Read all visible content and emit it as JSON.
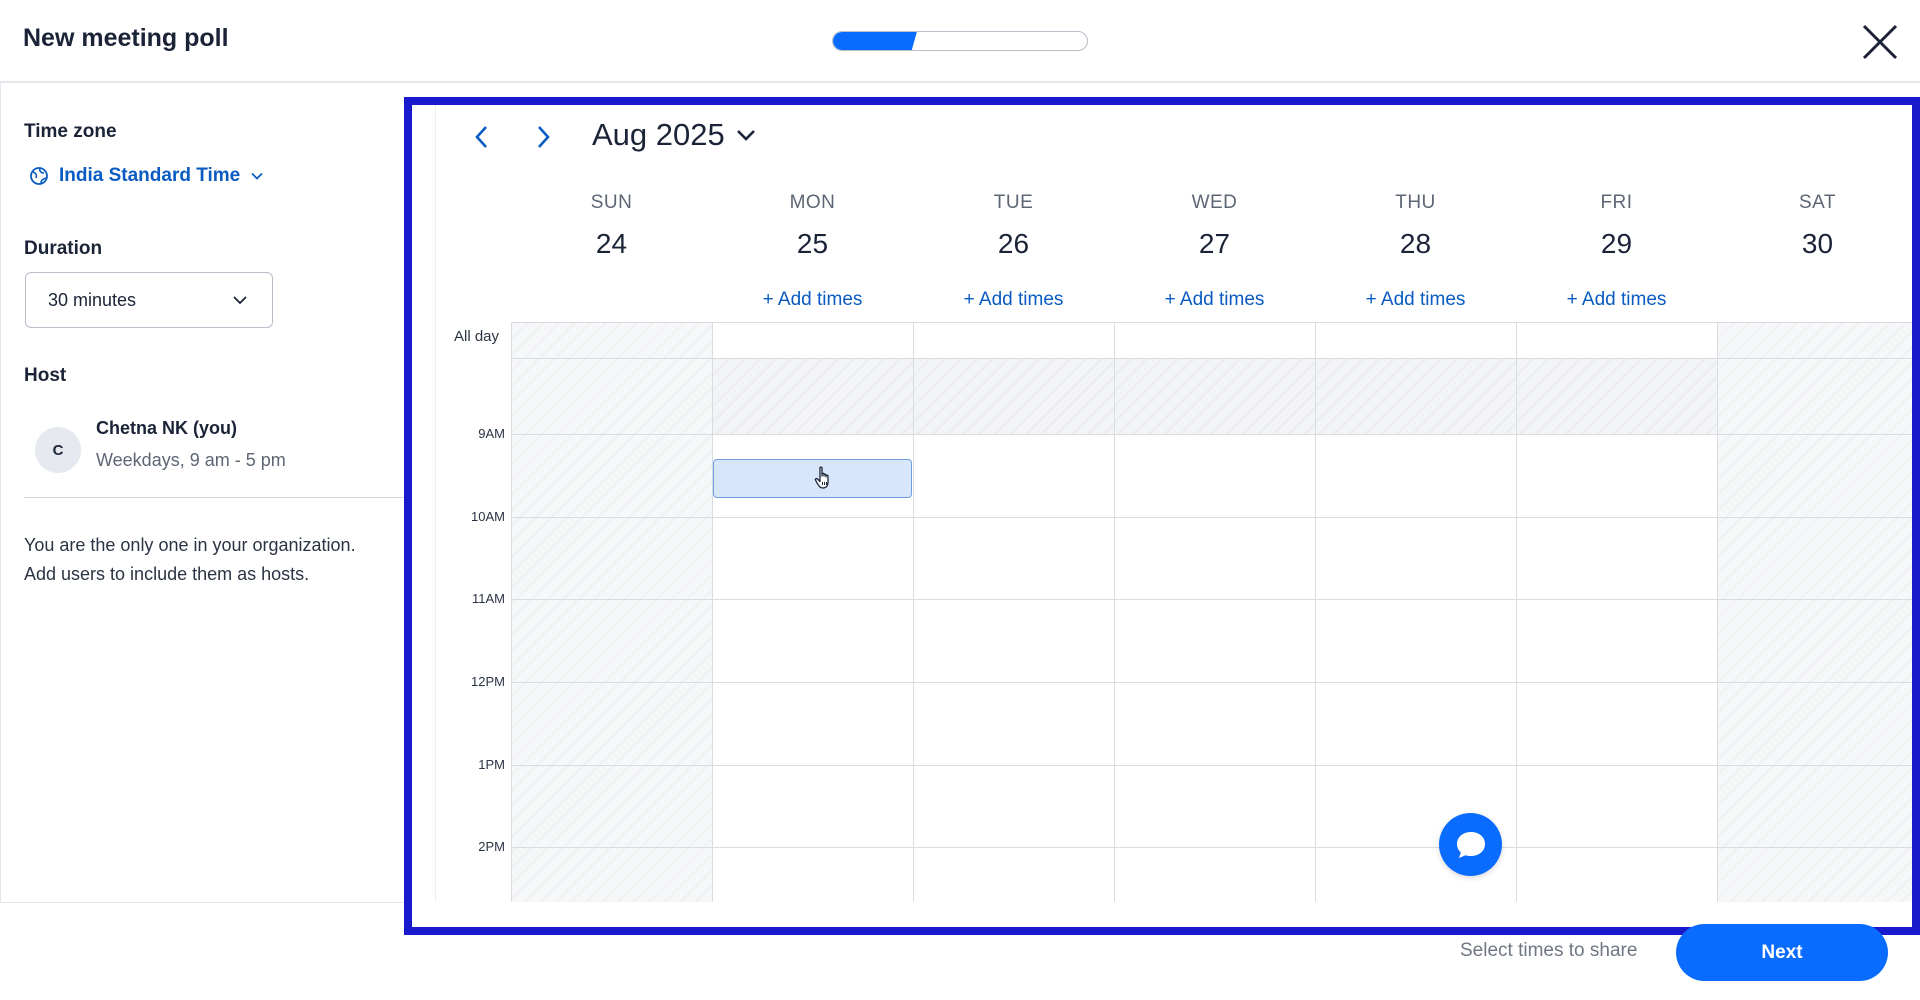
{
  "header": {
    "title": "New meeting poll",
    "progress_fraction": 0.33,
    "close_icon": "close-icon"
  },
  "sidebar": {
    "timezone_label": "Time zone",
    "timezone_value": "India Standard Time",
    "duration_label": "Duration",
    "duration_value": "30 minutes",
    "host_label": "Host",
    "host": {
      "initial": "C",
      "name": "Chetna NK (you)",
      "hours": "Weekdays, 9 am - 5 pm"
    },
    "org_note_line1": "You are the only one in your organization.",
    "org_note_line2": "Add users to include them as hosts."
  },
  "calendar": {
    "month_label": "Aug 2025",
    "days": [
      {
        "name": "SUN",
        "num": "24",
        "add_times": ""
      },
      {
        "name": "MON",
        "num": "25",
        "add_times": "+ Add times"
      },
      {
        "name": "TUE",
        "num": "26",
        "add_times": "+ Add times"
      },
      {
        "name": "WED",
        "num": "27",
        "add_times": "+ Add times"
      },
      {
        "name": "THU",
        "num": "28",
        "add_times": "+ Add times"
      },
      {
        "name": "FRI",
        "num": "29",
        "add_times": "+ Add times"
      },
      {
        "name": "SAT",
        "num": "30",
        "add_times": ""
      }
    ],
    "allday_label": "All day",
    "times": [
      "9AM",
      "10AM",
      "11AM",
      "12PM",
      "1PM",
      "2PM"
    ]
  },
  "footer": {
    "hint": "Select times to share",
    "next_label": "Next"
  },
  "colors": {
    "accent": "#0a6cff",
    "link": "#0b5cc2",
    "focus_frame": "#1a1acd",
    "selected_slot": "#d8e6fb"
  }
}
